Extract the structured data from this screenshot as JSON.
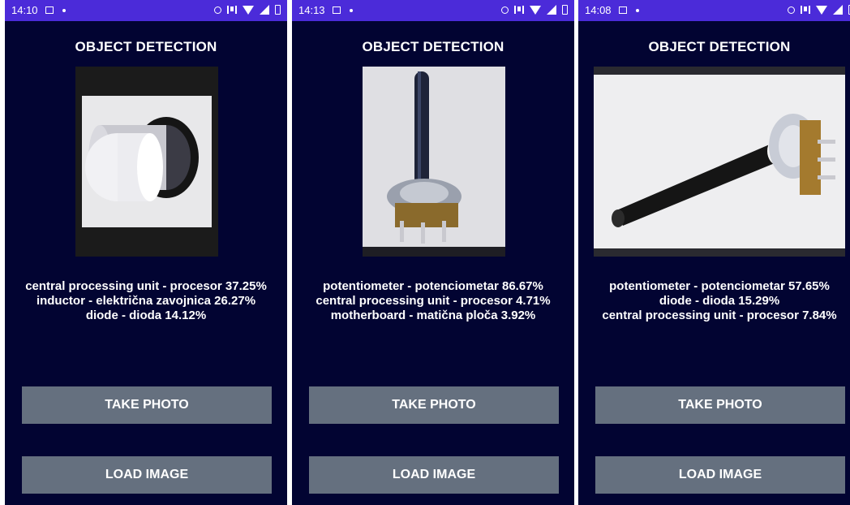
{
  "screens": [
    {
      "status_time": "14:10",
      "title": "OBJECT DETECTION",
      "results": [
        "central processing unit - procesor 37.25%",
        "inductor - električna zavojnica 26.27%",
        "diode - dioda 14.12%"
      ],
      "take_photo_label": "TAKE PHOTO",
      "load_image_label": "LOAD IMAGE"
    },
    {
      "status_time": "14:13",
      "title": "OBJECT DETECTION",
      "results": [
        "potentiometer - potenciometar 86.67%",
        "central processing unit - procesor 4.71%",
        "motherboard - matična ploča 3.92%"
      ],
      "take_photo_label": "TAKE PHOTO",
      "load_image_label": "LOAD IMAGE"
    },
    {
      "status_time": "14:08",
      "title": "OBJECT DETECTION",
      "results": [
        "potentiometer - potenciometar 57.65%",
        "diode - dioda 15.29%",
        "central processing unit - procesor 7.84%"
      ],
      "take_photo_label": "TAKE PHOTO",
      "load_image_label": "LOAD IMAGE"
    }
  ],
  "icons": [
    "image-notification-icon",
    "dot-icon",
    "data-saver-icon",
    "vibrate-icon",
    "wifi-icon",
    "signal-icon",
    "battery-icon"
  ],
  "colors": {
    "background": "#020432",
    "status_bar": "#4b2bd9",
    "button": "#65707f",
    "text": "#ffffff"
  }
}
